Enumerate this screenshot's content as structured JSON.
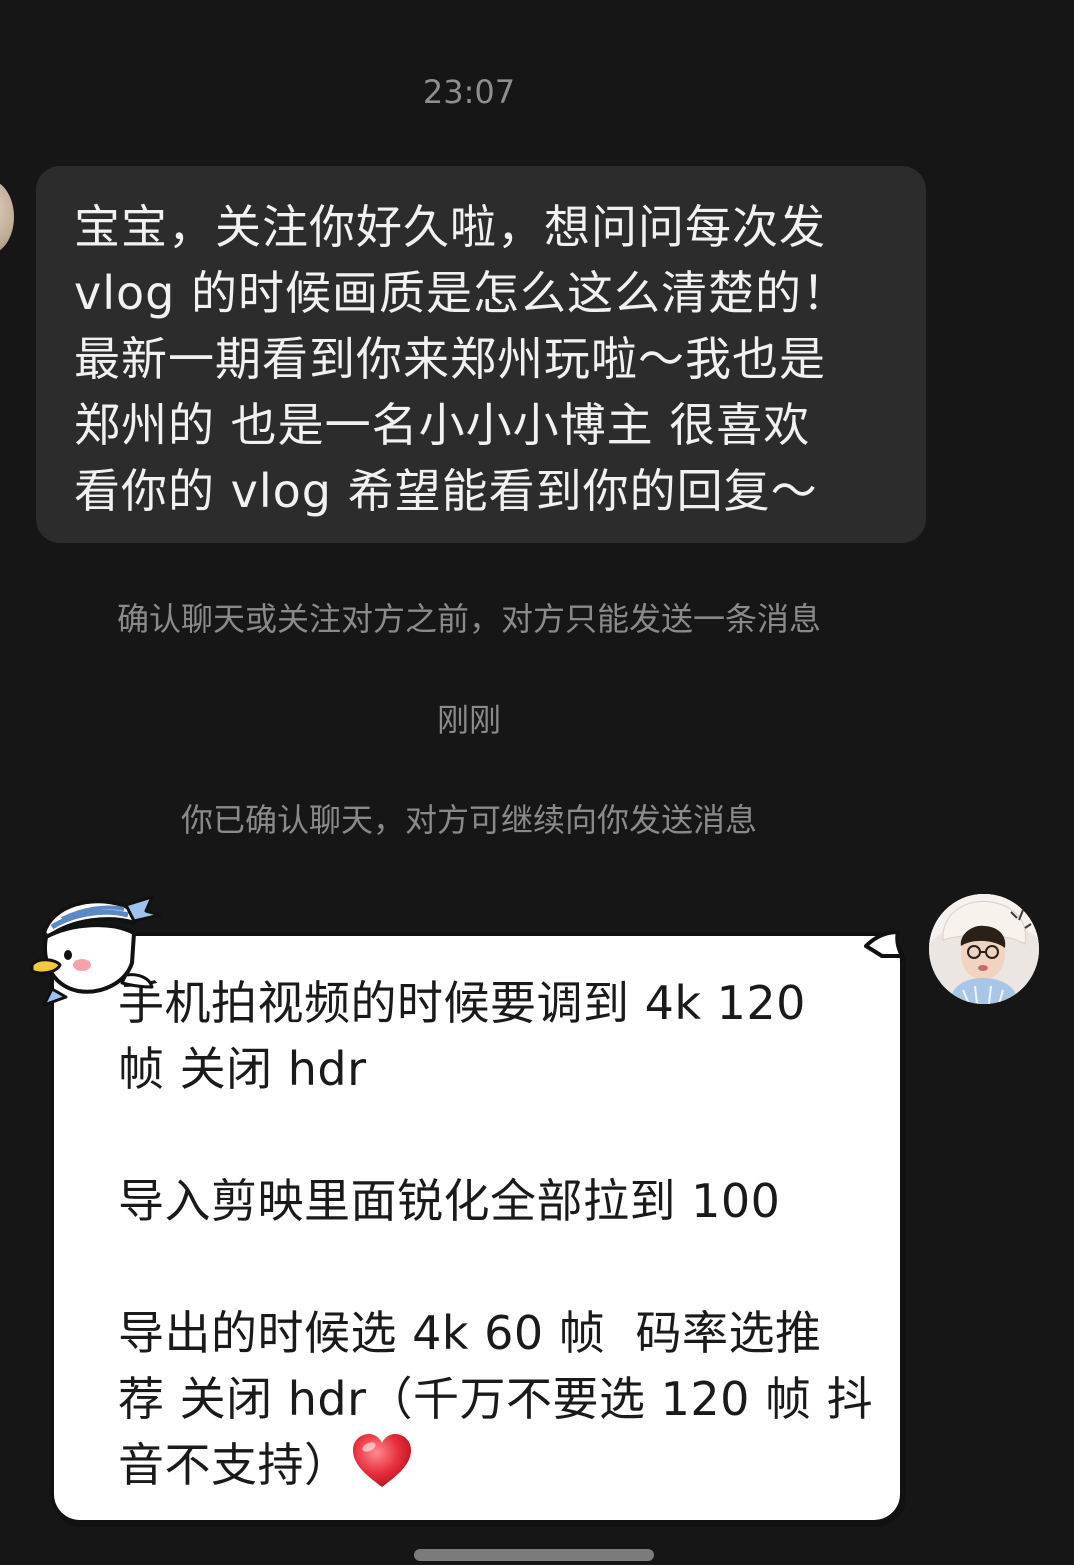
{
  "chat": {
    "timestamp": "23:07",
    "incoming_message": "宝宝，关注你好久啦，想问问每次发\nvlog 的时候画质是怎么这么清楚的！\n最新一期看到你来郑州玩啦～我也是\n郑州的 也是一名小小小博主 很喜欢\n看你的 vlog 希望能看到你的回复～",
    "notice_single_message": "确认聊天或关注对方之前，对方只能发送一条消息",
    "time_just_now": "刚刚",
    "notice_confirmed": "你已确认聊天，对方可继续向你发送消息",
    "reply_paragraph_1": "手机拍视频的时候要调到 4k 120\n帧 关闭 hdr",
    "reply_paragraph_2": "导入剪映里面锐化全部拉到 100",
    "reply_paragraph_3": "导出的时候选 4k 60 帧  码率选推\n荐 关闭 hdr（千万不要选 120 帧 抖\n音不支持）"
  },
  "icons": {
    "heart": "red-heart-emoji",
    "sticker": "duck-sailor-sticker",
    "peer_avatar": "peer-avatar",
    "my_avatar": "user-avatar"
  },
  "colors": {
    "background": "#161616",
    "incoming_bubble": "#2c2c2c",
    "outgoing_bubble": "#ffffff",
    "heart": "#e8303d"
  }
}
